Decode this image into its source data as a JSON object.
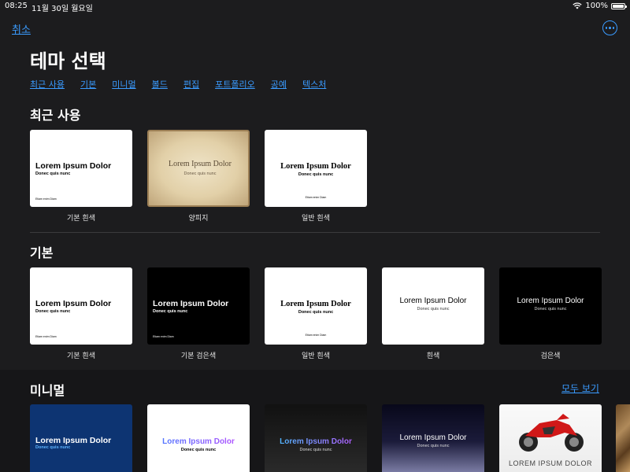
{
  "status": {
    "time": "08:25",
    "date": "11월 30일 월요일",
    "battery": "100%"
  },
  "header": {
    "cancel": "취소",
    "title": "테마 선택",
    "more_icon": "ellipsis-circle-icon"
  },
  "nav": [
    "최근 사용",
    "기본",
    "미니멀",
    "볼드",
    "편집",
    "포트폴리오",
    "공예",
    "텍스처"
  ],
  "sections": {
    "recent": {
      "title": "최근 사용",
      "captions": [
        "기본 흰색",
        "양피지",
        "일반 흰색"
      ]
    },
    "basic": {
      "title": "기본",
      "captions": [
        "기본 흰색",
        "기본 검은색",
        "일반 흰색",
        "흰색",
        "검은색"
      ]
    },
    "minimal": {
      "title": "미니멀",
      "see_all": "모두 보기"
    }
  },
  "thumb_text": {
    "heading": "Lorem Ipsum Dolor",
    "sub": "Donec quis nunc",
    "footer": "Etiam enim Diam",
    "heading_upper": "LOREM IPSUM DOLOR"
  },
  "colors": {
    "accent": "#3a9bff",
    "background": "#1c1c1e"
  }
}
